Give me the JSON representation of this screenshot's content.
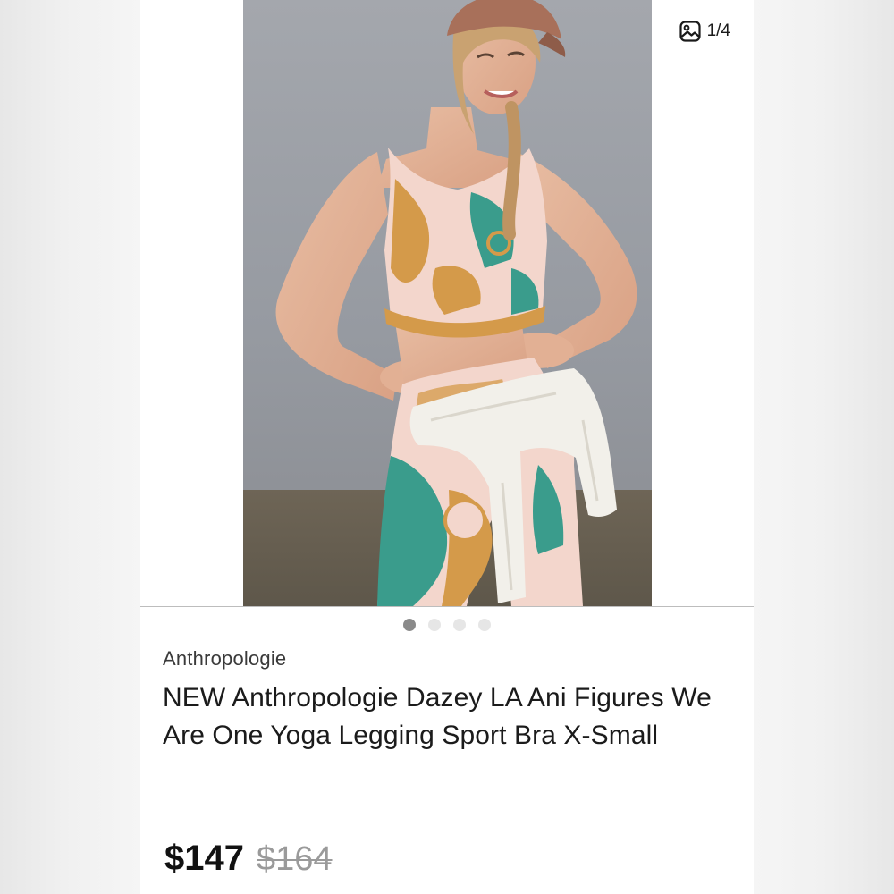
{
  "gallery": {
    "counter": "1/4",
    "icon": "gallery-icon",
    "dots": [
      {
        "active": true
      },
      {
        "active": false
      },
      {
        "active": false
      },
      {
        "active": false
      }
    ]
  },
  "listing": {
    "brand": "Anthropologie",
    "title": "NEW Anthropologie Dazey LA Ani Figures We Are One Yoga Legging Sport Bra X-Small",
    "price": "$147",
    "original_price": "$164"
  },
  "colors": {
    "accent_teal": "#3a9c8c",
    "print_tan": "#d49a4a",
    "print_pink": "#f3d6cc",
    "backdrop_gray": "#9a9ea5"
  }
}
